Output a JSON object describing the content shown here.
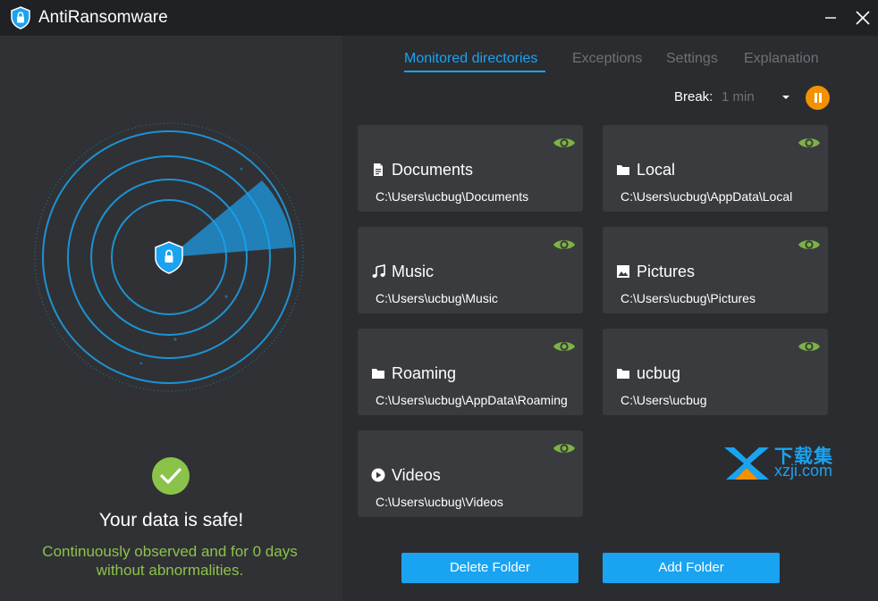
{
  "window": {
    "title": "AntiRansomware",
    "app_icon": "shield-lock-icon",
    "controls": [
      "minimize-icon",
      "close-icon"
    ]
  },
  "status": {
    "title": "Your data is safe!",
    "description": "Continuously observed and for 0 days without abnormalities.",
    "color": "#8bc34a"
  },
  "tabs": [
    {
      "label": "Monitored directories",
      "active": true
    },
    {
      "label": "Exceptions",
      "active": false
    },
    {
      "label": "Settings",
      "active": false
    },
    {
      "label": "Explanation",
      "active": false
    }
  ],
  "break_control": {
    "label": "Break:",
    "value": "1 min"
  },
  "folders": [
    {
      "name": "Documents",
      "path": "C:\\Users\\ucbug\\Documents",
      "icon": "document-icon"
    },
    {
      "name": "Local",
      "path": "C:\\Users\\ucbug\\AppData\\Local",
      "icon": "folder-icon"
    },
    {
      "name": "Music",
      "path": "C:\\Users\\ucbug\\Music",
      "icon": "music-icon"
    },
    {
      "name": "Pictures",
      "path": "C:\\Users\\ucbug\\Pictures",
      "icon": "image-icon"
    },
    {
      "name": "Roaming",
      "path": "C:\\Users\\ucbug\\AppData\\Roaming",
      "icon": "folder-icon"
    },
    {
      "name": "ucbug",
      "path": "C:\\Users\\ucbug",
      "icon": "folder-icon"
    },
    {
      "name": "Videos",
      "path": "C:\\Users\\ucbug\\Videos",
      "icon": "play-circle-icon"
    }
  ],
  "buttons": {
    "delete": "Delete Folder",
    "add": "Add Folder"
  },
  "watermark": {
    "text_cn": "下载集",
    "url": "xzji.com"
  },
  "colors": {
    "accent": "#1aa3f0",
    "safe_green": "#8bc34a",
    "eye_green": "#7cb342",
    "pause_orange": "#f39200"
  }
}
